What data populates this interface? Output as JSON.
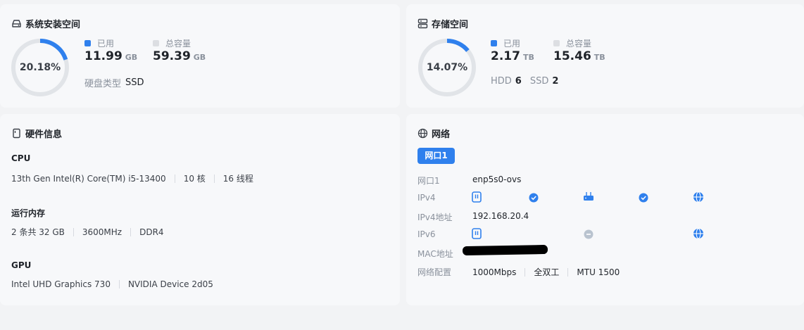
{
  "system_space": {
    "title": "系统安装空间",
    "percent_label": "20.18%",
    "used_fraction": 0.2018,
    "used_label": "已用",
    "used_value": "11.99",
    "used_unit": "GB",
    "total_label": "总容量",
    "total_value": "59.39",
    "total_unit": "GB",
    "disk_type_label": "硬盘类型",
    "disk_type_value": "SSD"
  },
  "storage_space": {
    "title": "存储空间",
    "percent_label": "14.07%",
    "used_fraction": 0.1407,
    "used_label": "已用",
    "used_value": "2.17",
    "used_unit": "TB",
    "total_label": "总容量",
    "total_value": "15.46",
    "total_unit": "TB",
    "hdd_label": "HDD",
    "hdd_count": "6",
    "ssd_label": "SSD",
    "ssd_count": "2"
  },
  "hardware": {
    "title": "硬件信息",
    "cpu_title": "CPU",
    "cpu_model": "13th Gen Intel(R) Core(TM) i5-13400",
    "cpu_cores": "10 核",
    "cpu_threads": "16 线程",
    "mem_title": "运行内存",
    "mem_size": "2 条共 32 GB",
    "mem_speed": "3600MHz",
    "mem_type": "DDR4",
    "gpu_title": "GPU",
    "gpu_1": "Intel UHD Graphics 730",
    "gpu_2": "NVIDIA Device 2d05"
  },
  "network": {
    "title": "网络",
    "tab_label": "网口1",
    "iface_label": "网口1",
    "iface_value": "enp5s0-ovs",
    "ipv4_label": "IPv4",
    "ipv4_addr_label": "IPv4地址",
    "ipv4_addr_value": "192.168.20.4",
    "ipv6_label": "IPv6",
    "mac_label": "MAC地址",
    "config_label": "网络配置",
    "speed": "1000Mbps",
    "duplex": "全双工",
    "mtu": "MTU 1500"
  },
  "colors": {
    "accent": "#2f80ed",
    "ring_track": "#e1e4e8",
    "total_dot": "#dcdee2",
    "ipv6_status": "#b9c3cf"
  }
}
